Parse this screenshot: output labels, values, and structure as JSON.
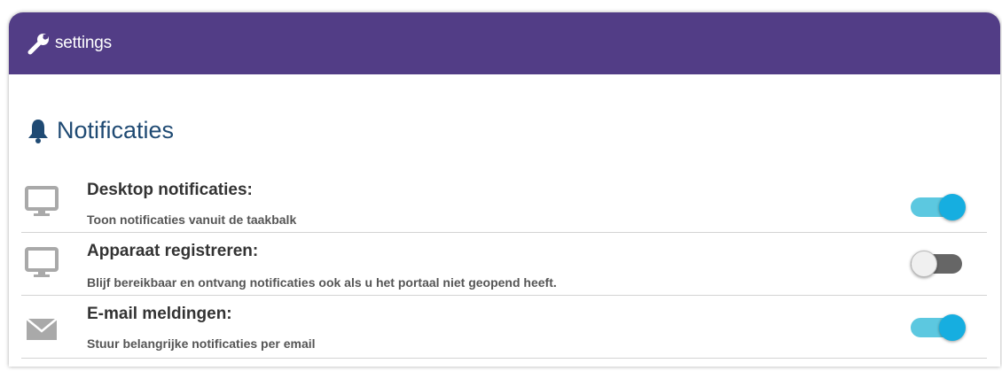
{
  "header": {
    "title": "settings",
    "icon": "wrench-icon",
    "color": "#523d86"
  },
  "section": {
    "title": "Notificaties",
    "icon": "bell-icon",
    "color": "#1f4a73"
  },
  "rows": [
    {
      "label": "Desktop notificaties:",
      "description": "Toon notificaties vanuit de taakbalk",
      "icon": "monitor-icon",
      "enabled": true
    },
    {
      "label": "Apparaat registreren:",
      "description": "Blijf bereikbaar en ontvang notificaties ook als u het portaal niet geopend heeft.",
      "icon": "monitor-icon",
      "enabled": false
    },
    {
      "label": "E-mail meldingen:",
      "description": "Stuur belangrijke notificaties per email",
      "icon": "envelope-icon",
      "enabled": true
    }
  ],
  "colors": {
    "toggle_on": "#16aee0",
    "toggle_off": "#666666"
  }
}
